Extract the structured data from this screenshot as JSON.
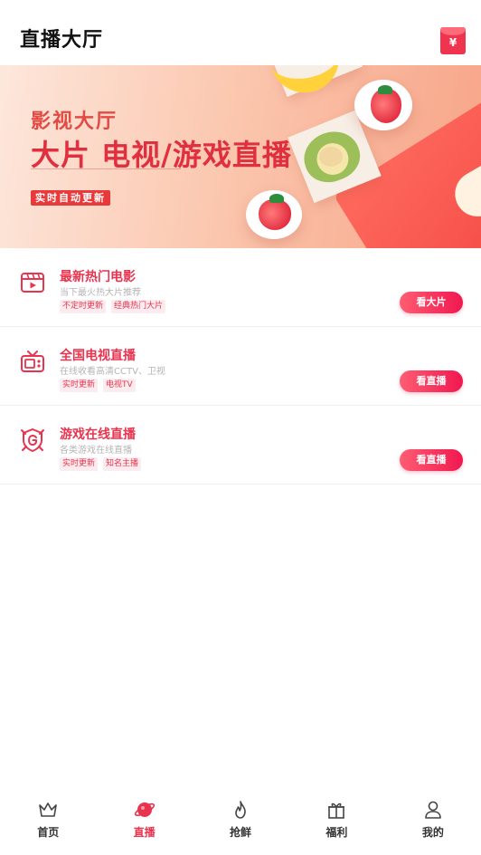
{
  "header": {
    "title": "直播大厅",
    "redpacket_icon": "red-envelope-icon",
    "redpacket_symbol": "¥"
  },
  "banner": {
    "line1": "影视大厅",
    "line2": "大片 电视/游戏直播",
    "tag": "实时自动更新"
  },
  "items": [
    {
      "icon": "film-icon",
      "title": "最新热门电影",
      "desc": "当下最火热大片推荐",
      "tags": [
        "不定时更新",
        "经典热门大片"
      ],
      "button": "看大片"
    },
    {
      "icon": "tv-icon",
      "title": "全国电视直播",
      "desc": "在线收看高清CCTV、卫视",
      "tags": [
        "实时更新",
        "电视TV"
      ],
      "button": "看直播"
    },
    {
      "icon": "game-badge-icon",
      "title": "游戏在线直播",
      "desc": "各类游戏在线直播",
      "tags": [
        "实时更新",
        "知名主播"
      ],
      "button": "看直播"
    }
  ],
  "nav": {
    "tabs": [
      {
        "label": "首页",
        "icon": "crown-icon"
      },
      {
        "label": "直播",
        "icon": "planet-icon",
        "active": true
      },
      {
        "label": "抢鲜",
        "icon": "flame-icon"
      },
      {
        "label": "福利",
        "icon": "gift-icon"
      },
      {
        "label": "我的",
        "icon": "user-icon"
      }
    ]
  },
  "colors": {
    "accent": "#e8344e",
    "button_start": "#ff5d73",
    "button_end": "#f0184f"
  }
}
